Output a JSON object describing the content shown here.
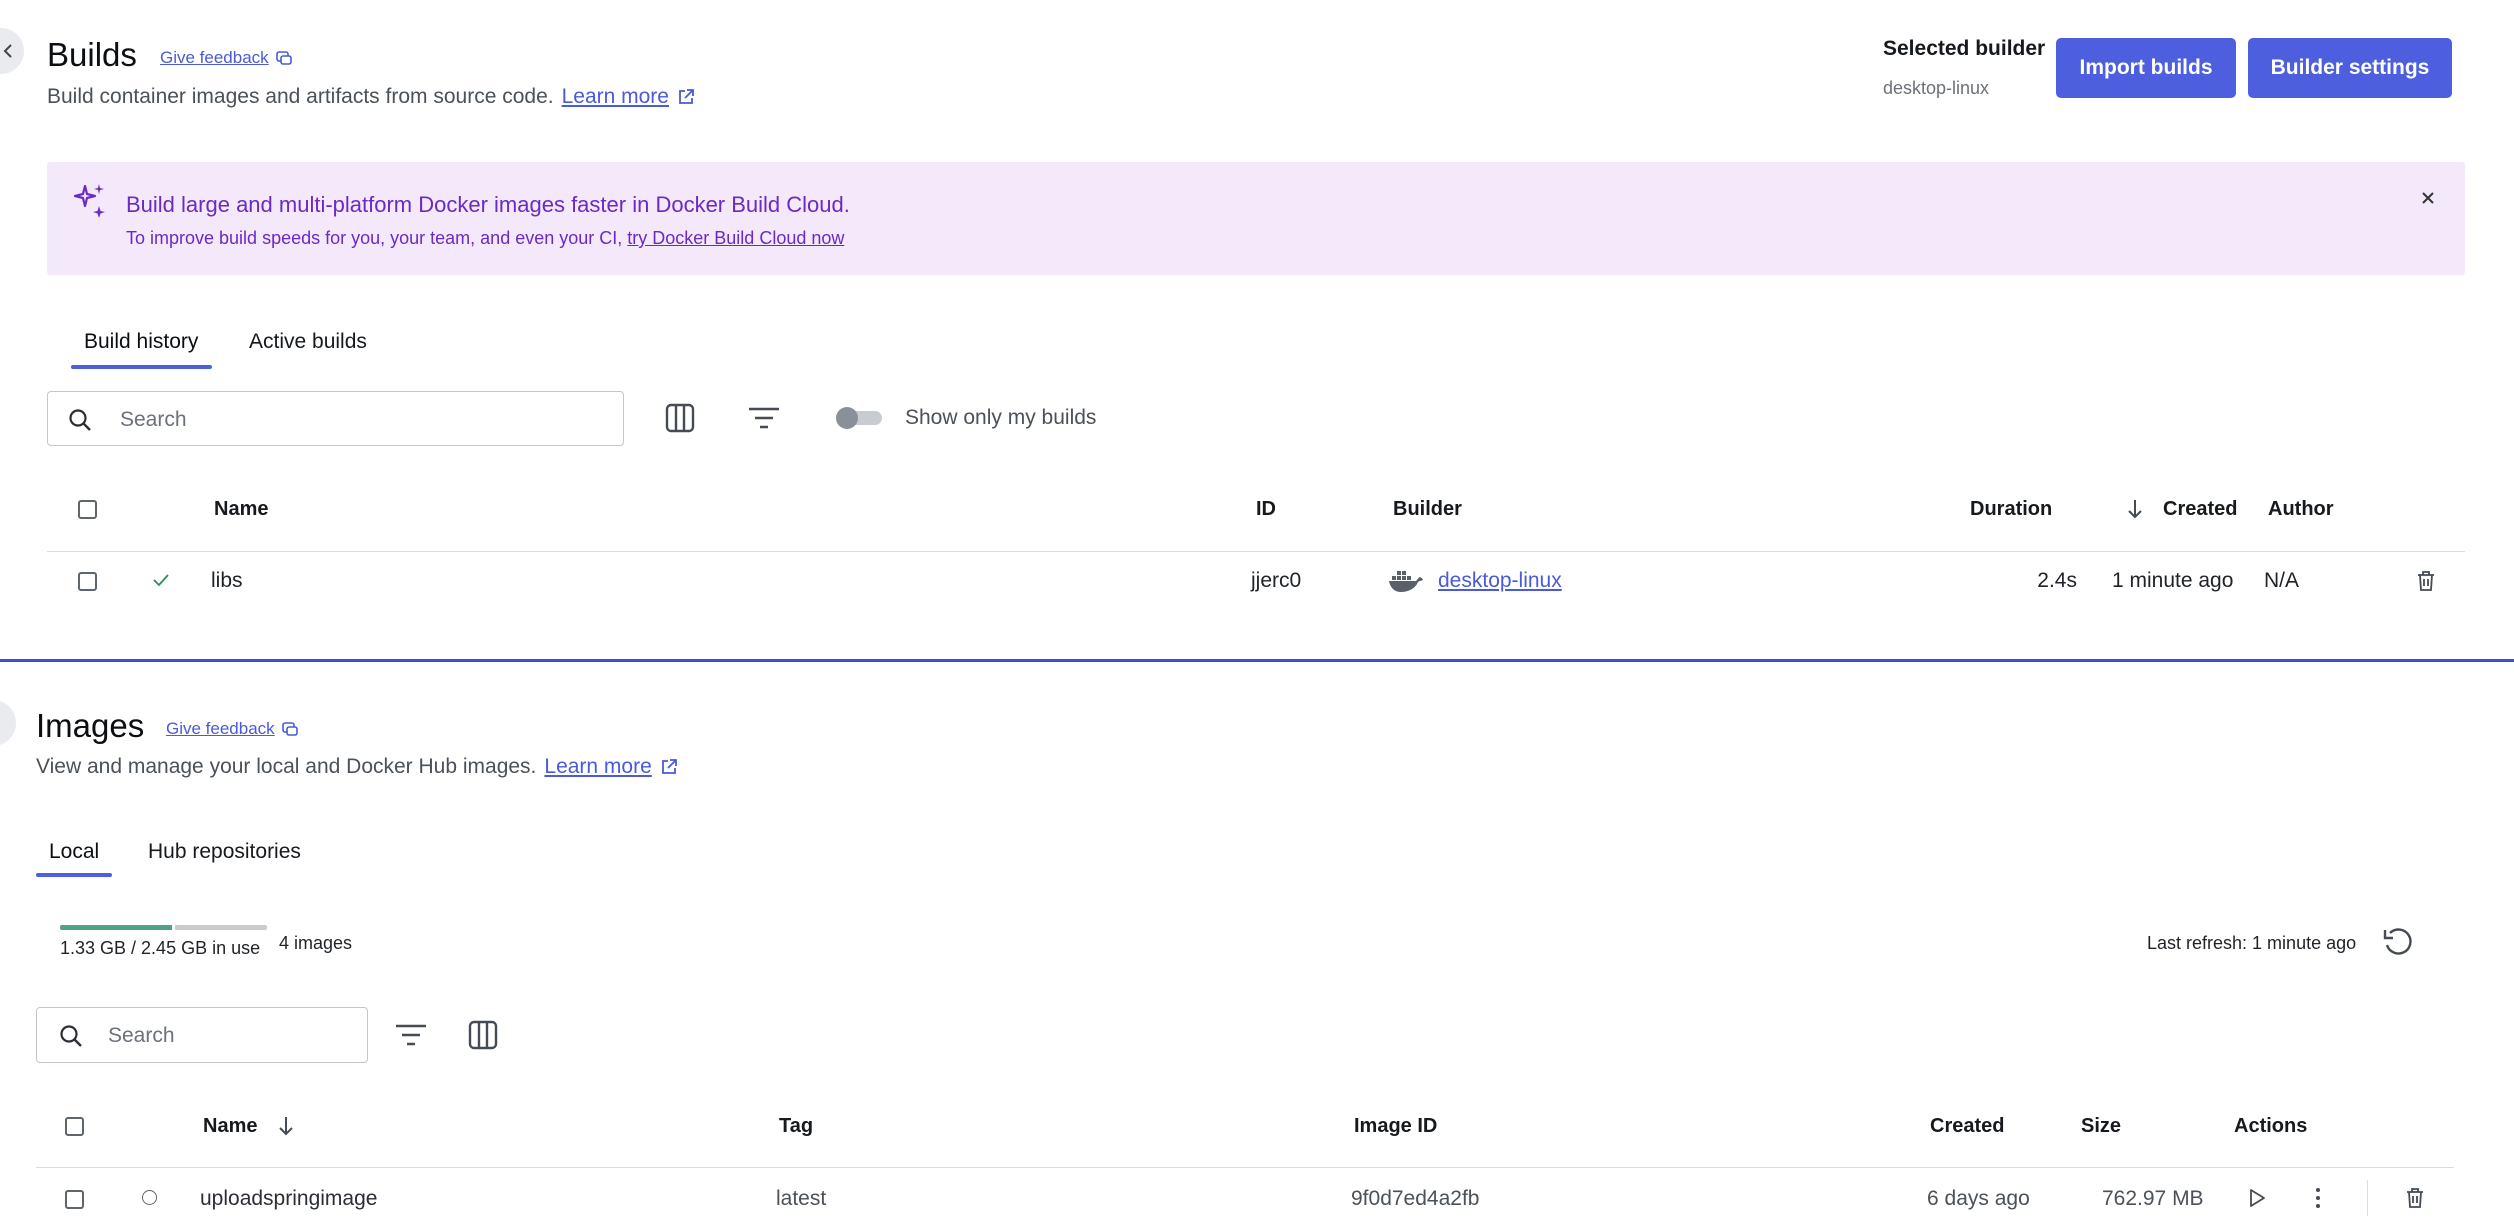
{
  "builds": {
    "title": "Builds",
    "feedback": "Give feedback",
    "subtitle": "Build container images and artifacts from source code.",
    "learn_more": "Learn more",
    "selected_builder_label": "Selected builder",
    "selected_builder_value": "desktop-linux",
    "import_button": "Import builds",
    "settings_button": "Builder settings",
    "banner": {
      "title": "Build large and multi-platform Docker images faster in Docker Build Cloud.",
      "text": "To improve build speeds for you, your team, and even your CI,",
      "link": "try Docker Build Cloud now",
      "bg_color": "#f4e8fb",
      "text_color": "#6a2bc4"
    },
    "tabs": [
      "Build history",
      "Active builds"
    ],
    "search_placeholder": "Search",
    "toggle_label": "Show only my builds",
    "columns": {
      "name": "Name",
      "id": "ID",
      "builder": "Builder",
      "duration": "Duration",
      "created": "Created",
      "author": "Author"
    },
    "rows": [
      {
        "name": "libs",
        "id": "jjerc0",
        "builder": "desktop-linux",
        "duration": "2.4s",
        "created": "1 minute ago",
        "author": "N/A",
        "status": "success"
      }
    ]
  },
  "images": {
    "title": "Images",
    "feedback": "Give feedback",
    "subtitle": "View and manage your local and Docker Hub images.",
    "learn_more": "Learn more",
    "tabs": [
      "Local",
      "Hub repositories"
    ],
    "usage_text": "1.33 GB / 2.45 GB in use",
    "usage_fraction": 0.54,
    "count": "4 images",
    "last_refresh": "Last refresh: 1 minute ago",
    "search_placeholder": "Search",
    "columns": {
      "name": "Name",
      "tag": "Tag",
      "image_id": "Image ID",
      "created": "Created",
      "size": "Size",
      "actions": "Actions"
    },
    "rows": [
      {
        "name": "uploadspringimage",
        "tag": "latest",
        "image_id": "9f0d7ed4a2fb",
        "created": "6 days ago",
        "size": "762.97 MB",
        "status": "unused"
      }
    ]
  },
  "colors": {
    "accent": "#4d5fdf",
    "divider": "#3d4fd6",
    "success": "#2e8b57",
    "usage_fill": "#4fa383"
  }
}
